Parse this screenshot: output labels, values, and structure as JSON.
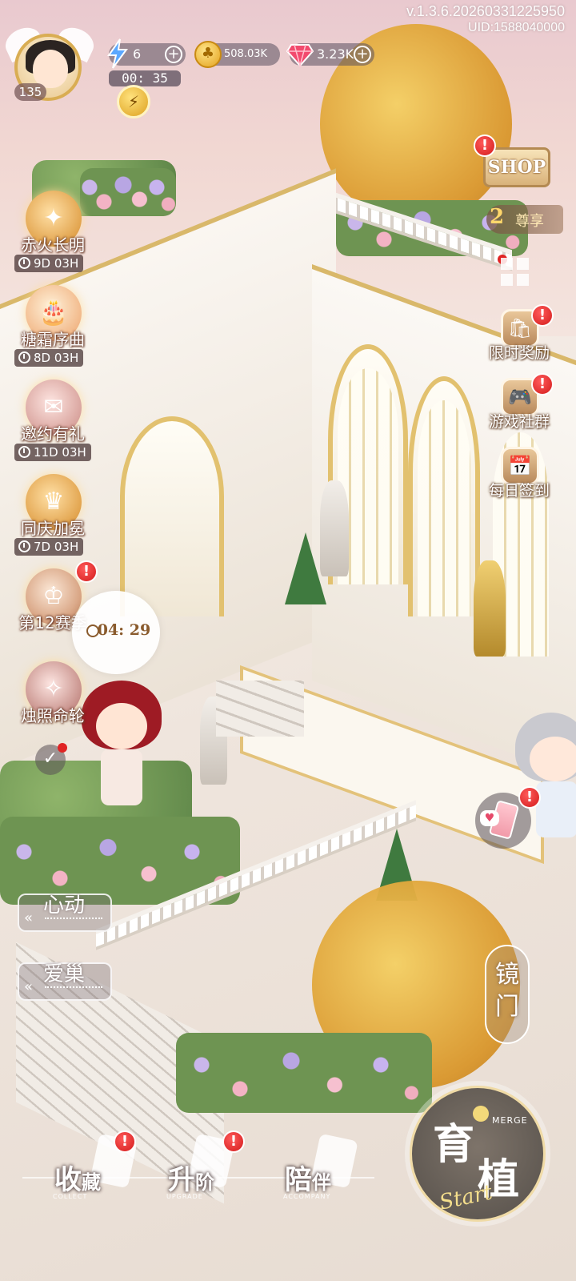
{
  "version": "v.1.3.6.20260331225950",
  "uid": "UID:1588040000",
  "player": {
    "level": "135"
  },
  "resources": {
    "energy": "6",
    "energy_timer": "00: 35",
    "coins": "508.03K",
    "gems": "3.23K"
  },
  "events": [
    {
      "label": "赤火长明",
      "countdown": "9D 03H"
    },
    {
      "label": "糖霜序曲",
      "countdown": "8D 03H"
    },
    {
      "label": "邀约有礼",
      "countdown": "11D 03H"
    },
    {
      "label": "同庆加冕",
      "countdown": "7D 03H"
    },
    {
      "label": "第12赛季",
      "countdown": ""
    },
    {
      "label": "烛照命轮",
      "countdown": ""
    }
  ],
  "season_bubble": {
    "time": "04: 29"
  },
  "right_menu": {
    "shop": "SHOP",
    "vip_level": "2",
    "vip_label": "尊享",
    "items": [
      {
        "label": "限时奖励"
      },
      {
        "label": "游戏社群"
      },
      {
        "label": "每日签到"
      }
    ]
  },
  "side_tabs": [
    {
      "label": "心动"
    },
    {
      "label": "爱巢"
    }
  ],
  "mirror_gate": {
    "c1": "镜",
    "c2": "门"
  },
  "badge_text": "!",
  "bottom_nav": [
    {
      "main": "收",
      "sub": "藏",
      "en": "COLLECT"
    },
    {
      "main": "升",
      "sub": "阶",
      "en": "UPGRADE"
    },
    {
      "main": "陪",
      "sub": "伴",
      "en": "ACCOMPANY"
    }
  ],
  "start_button": {
    "c1": "育",
    "c2": "植",
    "en": "MERGE",
    "script": "Start"
  },
  "colors": {
    "gold": "#d9ad53",
    "badge_red": "#d31c1c",
    "sky_pink": "#e9c9cf"
  },
  "icons": {
    "energy": "lightning-icon",
    "coin": "clover-coin-icon",
    "gem": "gem-icon",
    "clock": "clock-icon",
    "grid": "grid-icon"
  }
}
